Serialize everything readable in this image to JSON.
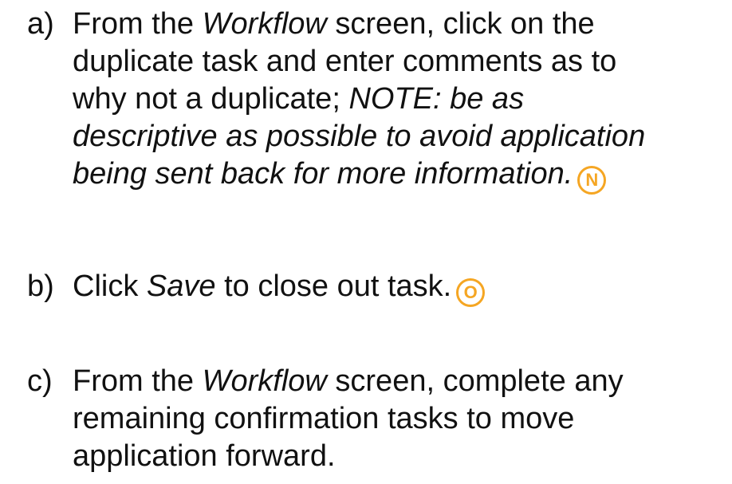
{
  "steps": [
    {
      "marker": "a)",
      "lines": [
        {
          "pre": "From the ",
          "em": "Workflow",
          "post": " screen, click on the"
        },
        {
          "pre": "duplicate task and enter comments as to",
          "em": "",
          "post": ""
        },
        {
          "pre": "why not a duplicate; ",
          "em": "NOTE: be as",
          "post": ""
        },
        {
          "pre": "",
          "em": "descriptive as possible to avoid application",
          "post": ""
        },
        {
          "pre": "",
          "em": "being sent back for more information.",
          "post": ""
        }
      ],
      "callout": "N"
    },
    {
      "marker": "b)",
      "lines": [
        {
          "pre": "Click ",
          "em": "Save",
          "post": " to close out task."
        }
      ],
      "callout": "O"
    },
    {
      "marker": "c)",
      "lines": [
        {
          "pre": "From the ",
          "em": "Workflow",
          "post": " screen, complete any"
        },
        {
          "pre": "remaining confirmation tasks to move",
          "em": "",
          "post": ""
        },
        {
          "pre": "application forward.",
          "em": "",
          "post": ""
        }
      ]
    }
  ],
  "colors": {
    "callout": "#f5a623",
    "text": "#111111"
  }
}
